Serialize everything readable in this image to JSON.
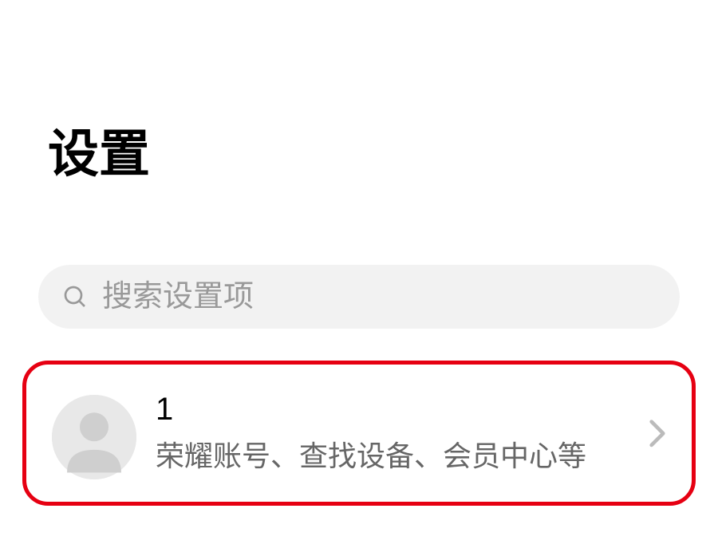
{
  "header": {
    "title": "设置"
  },
  "search": {
    "placeholder": "搜索设置项"
  },
  "account": {
    "title": "1",
    "subtitle": "荣耀账号、查找设备、会员中心等"
  }
}
